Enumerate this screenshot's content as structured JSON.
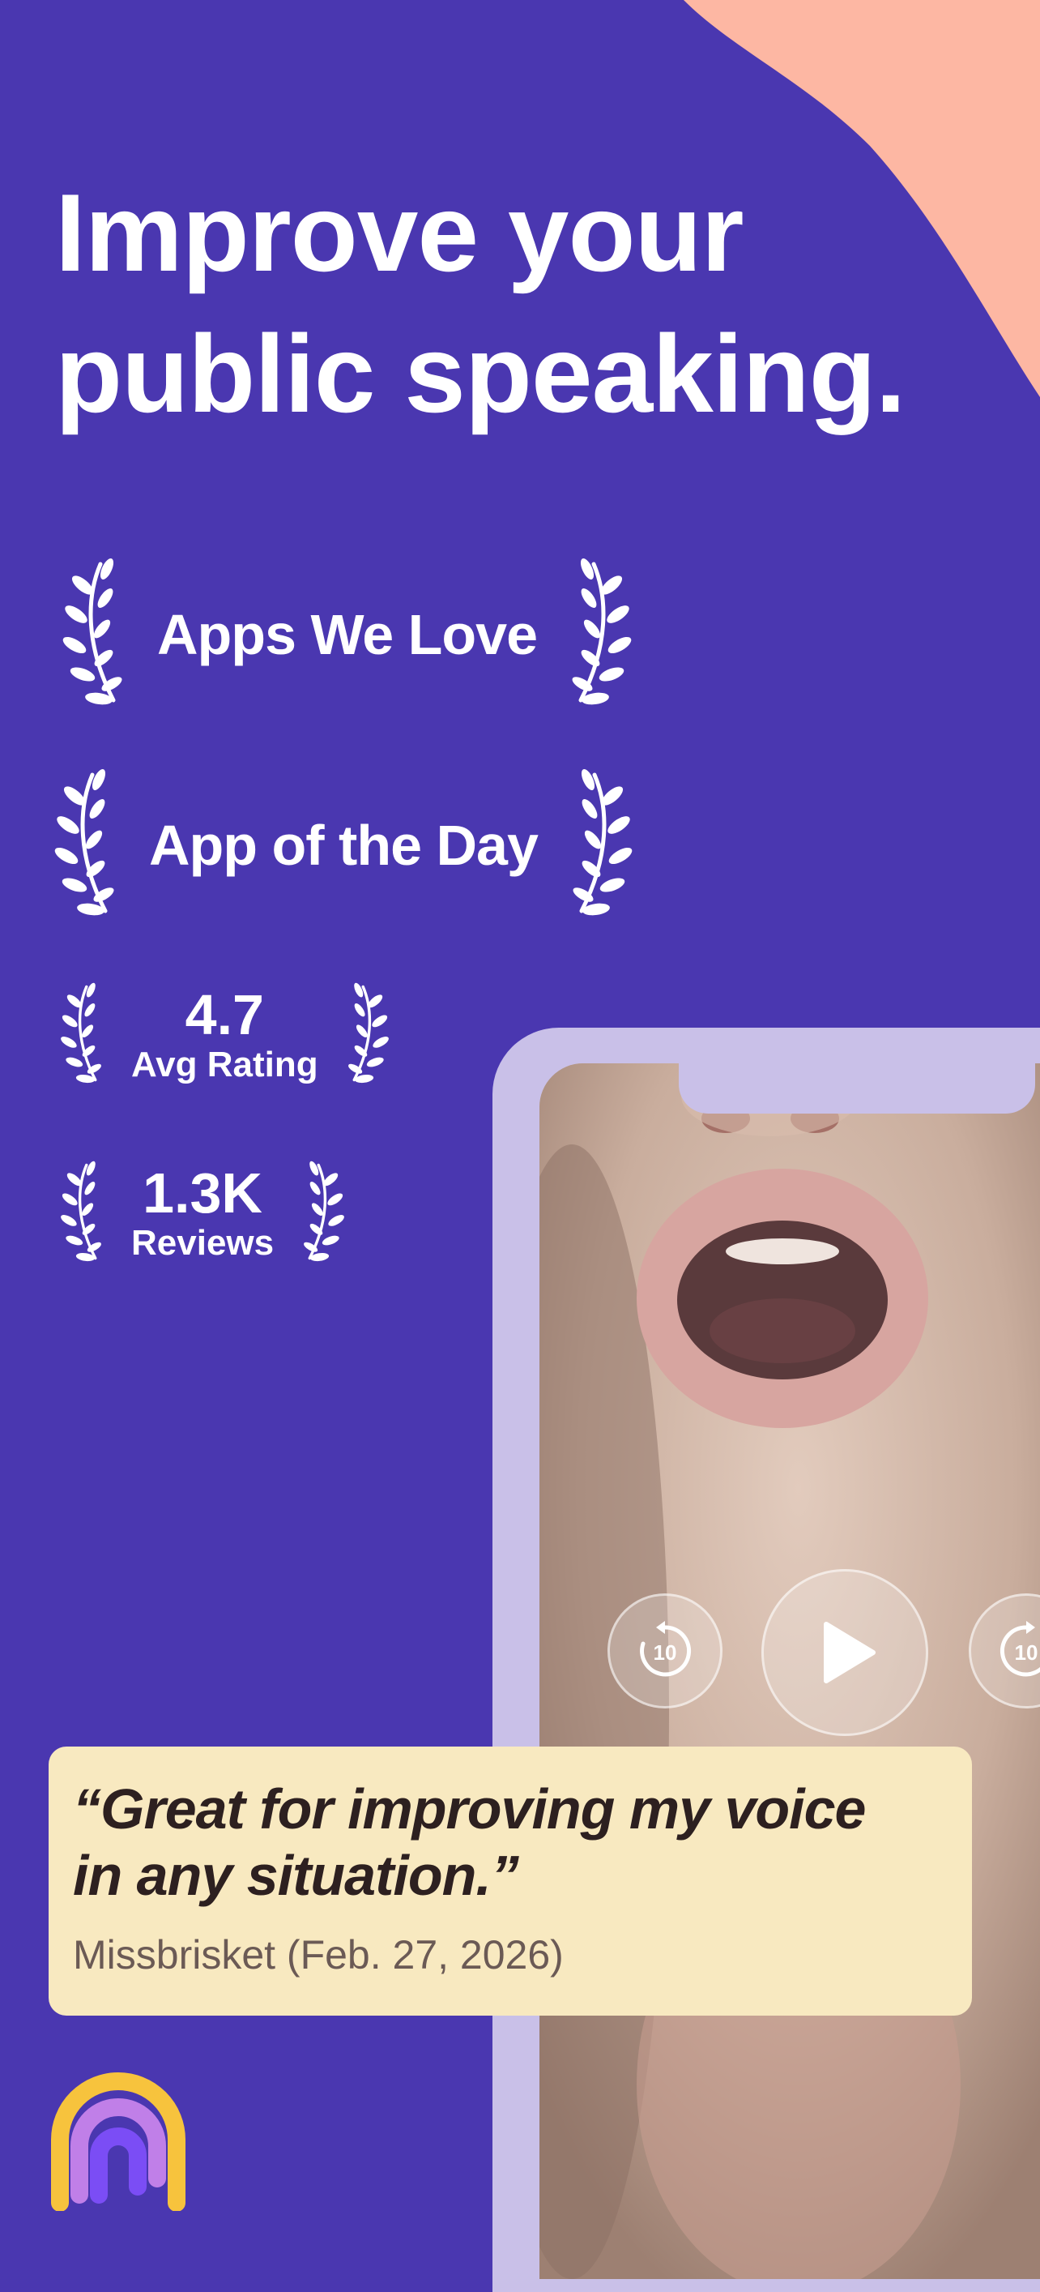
{
  "headline": {
    "line1": "Improve your",
    "line2": "public speaking."
  },
  "awards": [
    {
      "label": "Apps We Love"
    },
    {
      "label": "App of the Day"
    }
  ],
  "stats": [
    {
      "value": "4.7",
      "label": "Avg Rating"
    },
    {
      "value": "1.3K",
      "label": "Reviews"
    }
  ],
  "player": {
    "rewind_label": "10",
    "forward_label": "10"
  },
  "review": {
    "quote_line1": "“Great for improving my voice",
    "quote_line2": "in any situation.”",
    "author": "Missbrisket (Feb. 27, 2026)"
  },
  "colors": {
    "background": "#4a37b0",
    "accent_blob": "#fdb7a3",
    "card": "#f8e9c0",
    "phone_frame": "#c9c0e8"
  },
  "icons": [
    "laurel-icon",
    "rewind-10-icon",
    "play-icon",
    "forward-10-icon",
    "app-logo"
  ]
}
